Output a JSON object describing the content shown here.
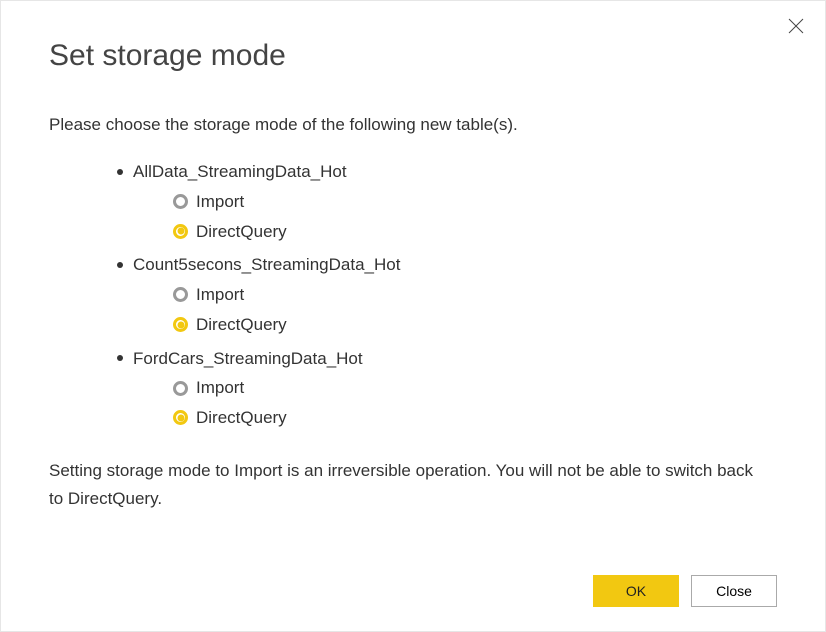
{
  "title": "Set storage mode",
  "intro": "Please choose the storage mode of the following new table(s).",
  "tables": [
    {
      "name": "AllData_StreamingData_Hot",
      "options": [
        {
          "label": "Import",
          "selected": false
        },
        {
          "label": "DirectQuery",
          "selected": true
        }
      ]
    },
    {
      "name": "Count5secons_StreamingData_Hot",
      "options": [
        {
          "label": "Import",
          "selected": false
        },
        {
          "label": "DirectQuery",
          "selected": true
        }
      ]
    },
    {
      "name": "FordCars_StreamingData_Hot",
      "options": [
        {
          "label": "Import",
          "selected": false
        },
        {
          "label": "DirectQuery",
          "selected": true
        }
      ]
    }
  ],
  "warning": "Setting storage mode to Import is an irreversible operation. You will not be able to switch back to DirectQuery.",
  "buttons": {
    "ok": "OK",
    "close": "Close"
  }
}
